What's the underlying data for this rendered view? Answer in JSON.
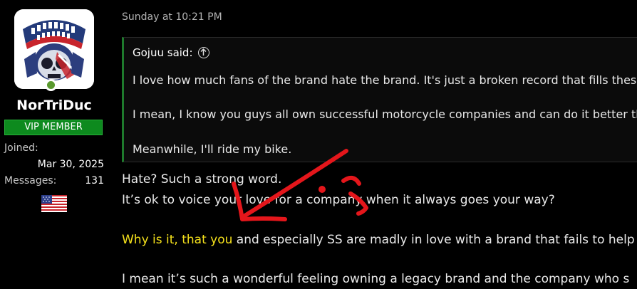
{
  "user": {
    "name": "NorTriDuc",
    "badge": "VIP MEMBER",
    "joined_label": "Joined:",
    "joined_value": "Mar 30, 2025",
    "messages_label": "Messages:",
    "messages_value": "131",
    "flag_icon": "us-flag-icon",
    "avatar_icon": "american-triumph-skull-avatar",
    "online_color": "#5a9a2e"
  },
  "post": {
    "timestamp": "Sunday at 10:21 PM",
    "quote": {
      "author_line": "Gojuu said:",
      "lines": [
        "I love how much fans of the brand hate the brand. It's just a broken record that fills these fo",
        "I mean, I know you guys all own successful motorcycle companies and can do it better than",
        "Meanwhile, I'll ride my bike."
      ]
    },
    "body": {
      "line1": "Hate? Such a strong word.",
      "line2": "It’s ok to voice your love for a company when it always goes your way?",
      "line3_highlight": "Why is it, that you",
      "line3_rest": " and especially SS are madly in love with a brand that fails to help",
      "line4": "I mean it’s such a wonderful feeling owning a legacy brand and the company who s"
    },
    "accent_color": "#f5e11b",
    "annotation_color": "#e4161b"
  }
}
